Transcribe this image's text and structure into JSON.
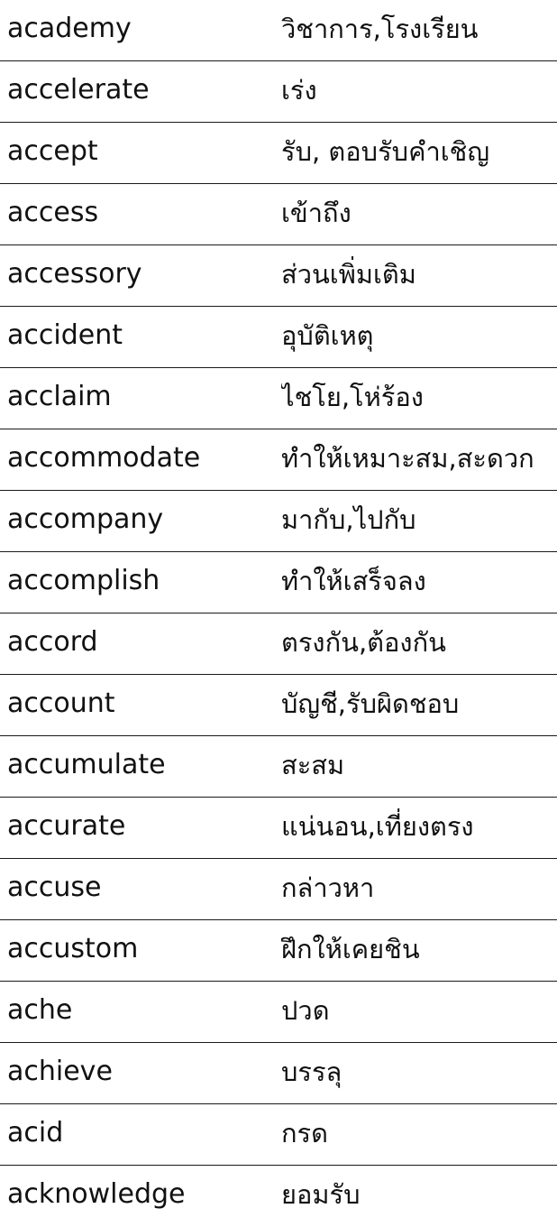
{
  "vocabulary": [
    {
      "word": "academy",
      "meaning": "วิชาการ,โรงเรียน"
    },
    {
      "word": "accelerate",
      "meaning": "เร่ง"
    },
    {
      "word": "accept",
      "meaning": "รับ, ตอบรับคำเชิญ"
    },
    {
      "word": "access",
      "meaning": "เข้าถึง"
    },
    {
      "word": "accessory",
      "meaning": "ส่วนเพิ่มเติม"
    },
    {
      "word": "accident",
      "meaning": "อุบัติเหตุ"
    },
    {
      "word": "acclaim",
      "meaning": "ไชโย,โห่ร้อง"
    },
    {
      "word": "accommodate",
      "meaning": "ทำให้เหมาะสม,สะดวก"
    },
    {
      "word": "accompany",
      "meaning": "มากับ,ไปกับ"
    },
    {
      "word": "accomplish",
      "meaning": "ทำให้เสร็จลง"
    },
    {
      "word": "accord",
      "meaning": "ตรงกัน,ต้องกัน"
    },
    {
      "word": "account",
      "meaning": "บัญชี,รับผิดชอบ"
    },
    {
      "word": "accumulate",
      "meaning": "สะสม"
    },
    {
      "word": "accurate",
      "meaning": "แน่นอน,เที่ยงตรง"
    },
    {
      "word": "accuse",
      "meaning": "กล่าวหา"
    },
    {
      "word": "accustom",
      "meaning": "ฝึกให้เคยชิน"
    },
    {
      "word": "ache",
      "meaning": "ปวด"
    },
    {
      "word": "achieve",
      "meaning": "บรรลุ"
    },
    {
      "word": "acid",
      "meaning": "กรด"
    },
    {
      "word": "acknowledge",
      "meaning": "ยอมรับ"
    }
  ]
}
